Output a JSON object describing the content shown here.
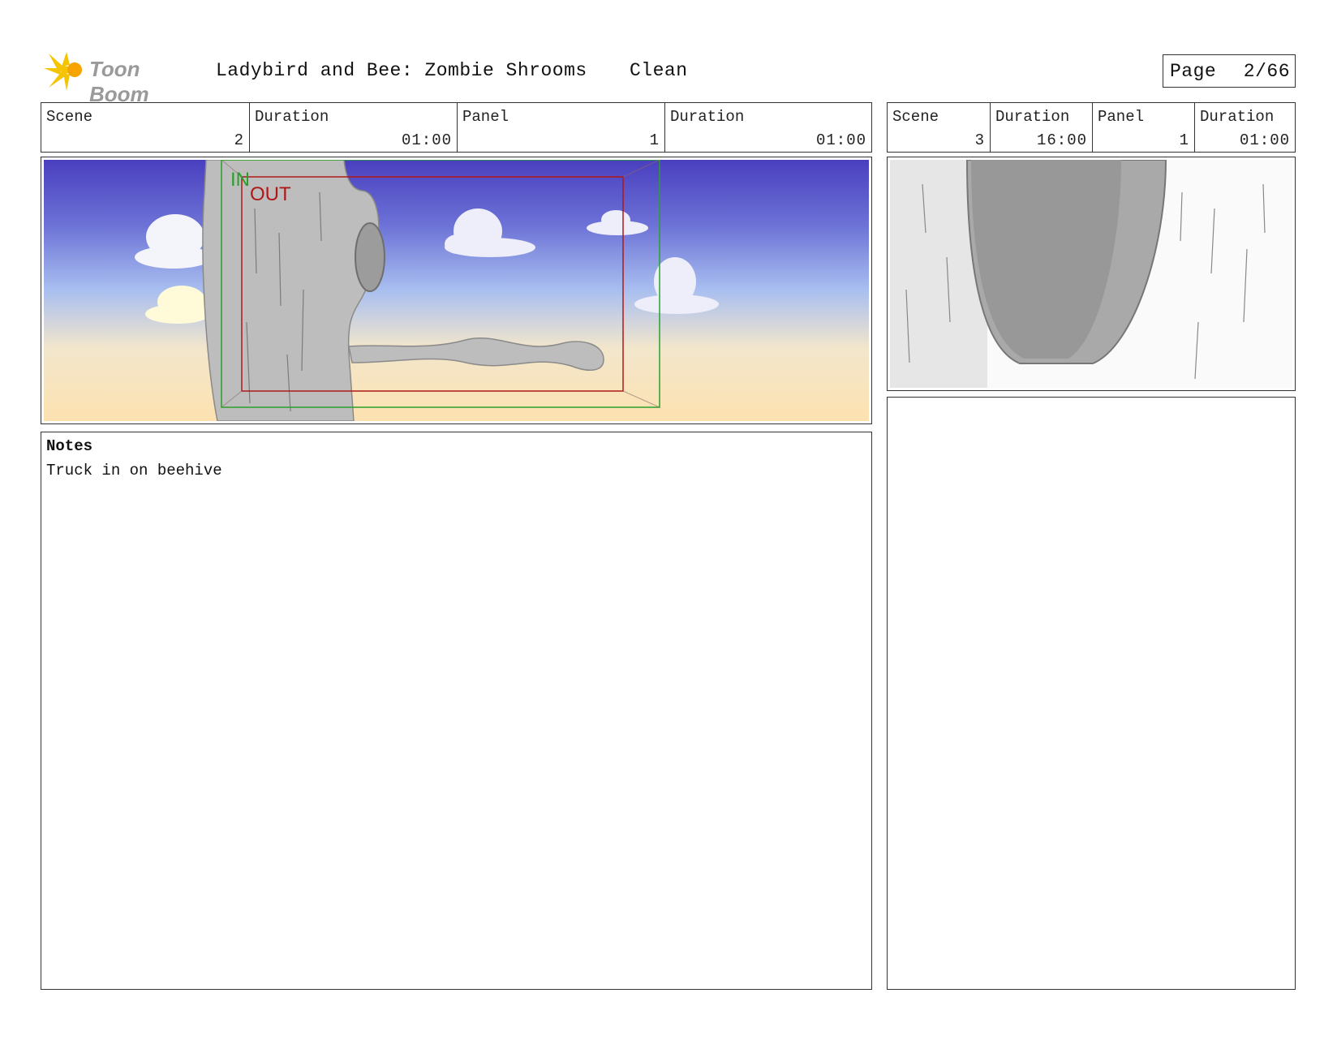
{
  "header": {
    "logo_text": "Toon Boom",
    "title": "Ladybird and Bee: Zombie Shrooms",
    "status": "Clean",
    "page_label": "Page",
    "page_number": "2/66"
  },
  "left_panel": {
    "scene_label": "Scene",
    "scene_value": "2",
    "scene_duration_label": "Duration",
    "scene_duration_value": "01:00",
    "panel_label": "Panel",
    "panel_value": "1",
    "panel_duration_label": "Duration",
    "panel_duration_value": "01:00",
    "camera_in_label": "IN",
    "camera_out_label": "OUT"
  },
  "right_panel": {
    "scene_label": "Scene",
    "scene_value": "3",
    "scene_duration_label": "Duration",
    "scene_duration_value": "16:00",
    "panel_label": "Panel",
    "panel_value": "1",
    "panel_duration_label": "Duration",
    "panel_duration_value": "01:00"
  },
  "notes": {
    "heading": "Notes",
    "text": "Truck in on beehive"
  },
  "colors": {
    "sky_top": "#4a3fbf",
    "sky_bottom": "#fde2b0",
    "tree_gray": "#bdbdbd",
    "camera_in": "#2aa02a",
    "camera_out": "#b01818",
    "logo_yellow": "#f5c400"
  }
}
